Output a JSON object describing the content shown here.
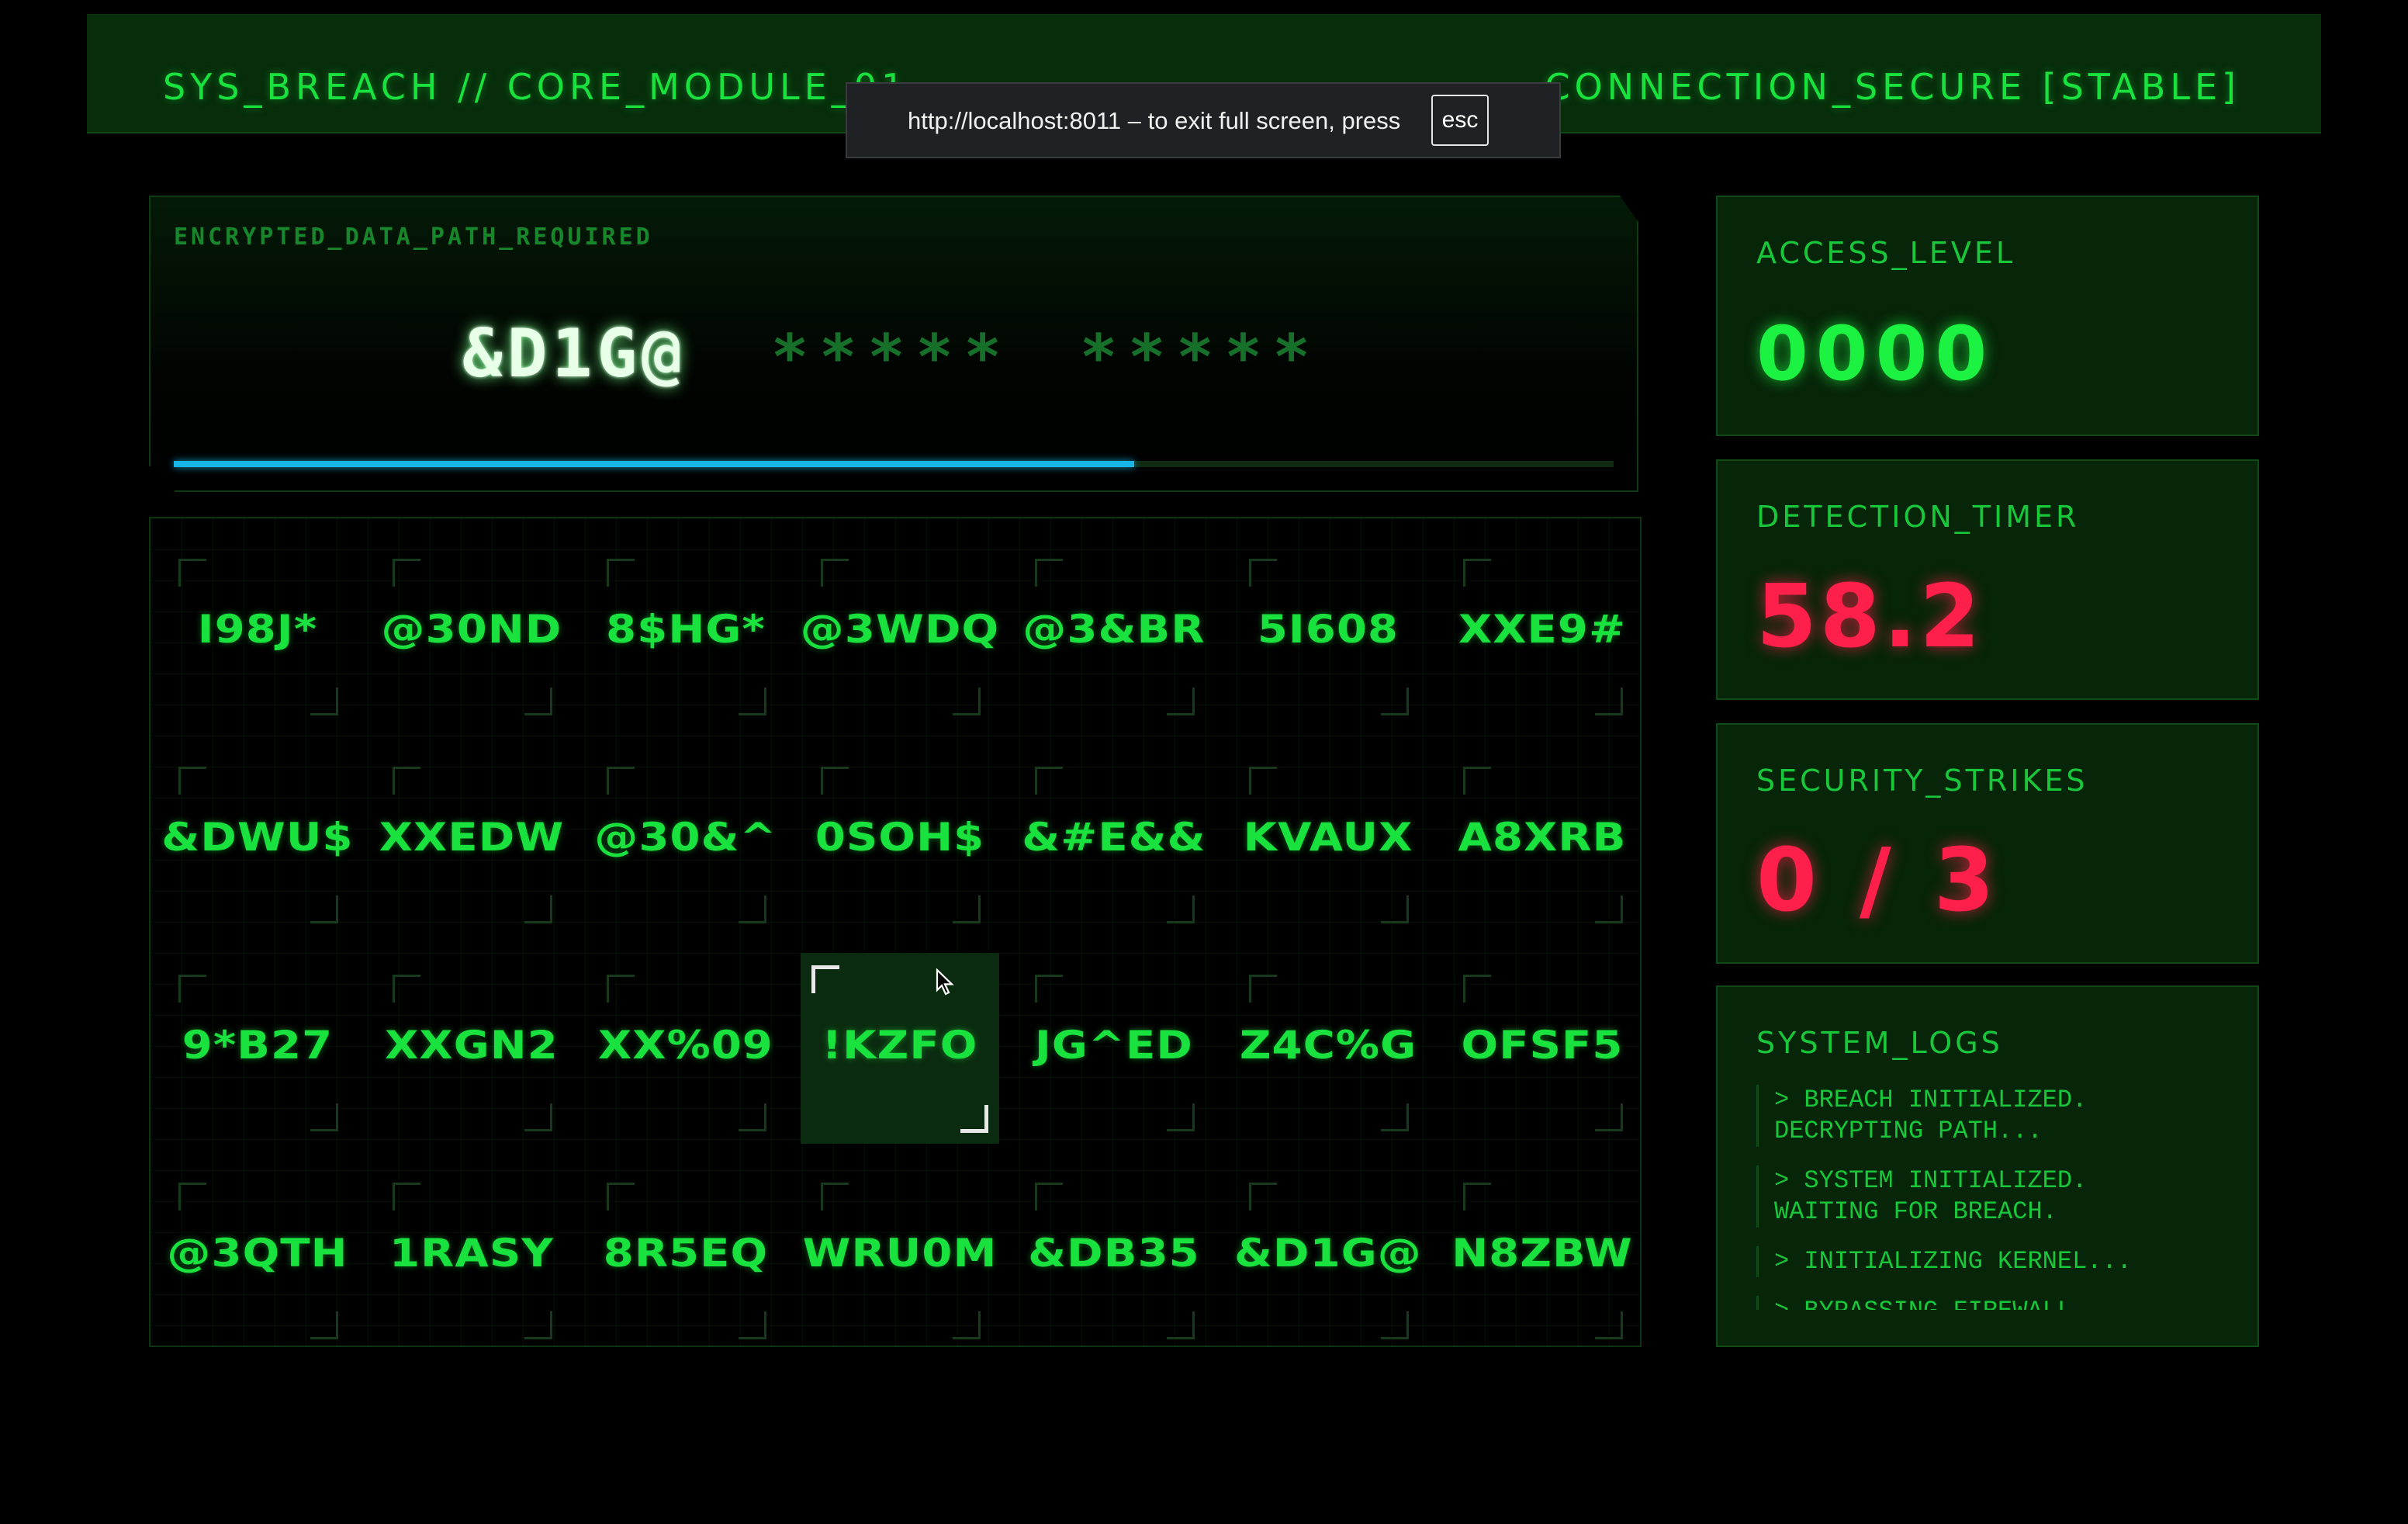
{
  "header": {
    "title": "SYS_BREACH // CORE_MODULE_01",
    "status": "CONNECTION_SECURE [STABLE]"
  },
  "fullscreen_notice": {
    "text": "http://localhost:8011 – to exit full screen, press",
    "key": "esc"
  },
  "target": {
    "label": "ENCRYPTED_DATA_PATH_REQUIRED",
    "revealed": "&D1G@",
    "hidden": [
      "*****",
      "*****"
    ],
    "progress": 0.667
  },
  "grid": {
    "rows": [
      [
        "I98J*",
        "@30ND",
        "8$HG*",
        "@3WDQ",
        "@3&BR",
        "5I608",
        "XXE9#"
      ],
      [
        "&DWU$",
        "XXEDW",
        "@30&^",
        "0SOH$",
        "&#E&&",
        "KVAUX",
        "A8XRB"
      ],
      [
        "9*B27",
        "XXGN2",
        "XX%09",
        "!KZFO",
        "JG^ED",
        "Z4C%G",
        "OFSF5"
      ],
      [
        "@3QTH",
        "1RASY",
        "8R5EQ",
        "WRU0M",
        "&DB35",
        "&D1G@",
        "N8ZBW"
      ]
    ],
    "selected": {
      "row": 2,
      "col": 3
    }
  },
  "access_level": {
    "label": "ACCESS_LEVEL",
    "value": "0000"
  },
  "detection_timer": {
    "label": "DETECTION_TIMER",
    "value": "58.2"
  },
  "security_strikes": {
    "label": "SECURITY_STRIKES",
    "value": "0 / 3"
  },
  "system_logs": {
    "label": "SYSTEM_LOGS",
    "entries": [
      "> BREACH INITIALIZED.\nDECRYPTING PATH...",
      "> SYSTEM INITIALIZED.\nWAITING FOR BREACH.",
      "> INITIALIZING KERNEL...",
      "> BYPASSING FIREWALL..."
    ]
  },
  "colors": {
    "primary_green": "#19e23e",
    "alert_red": "#ff1f4b",
    "progress_blue": "#19b5e6",
    "panel_bg": "#072509"
  }
}
